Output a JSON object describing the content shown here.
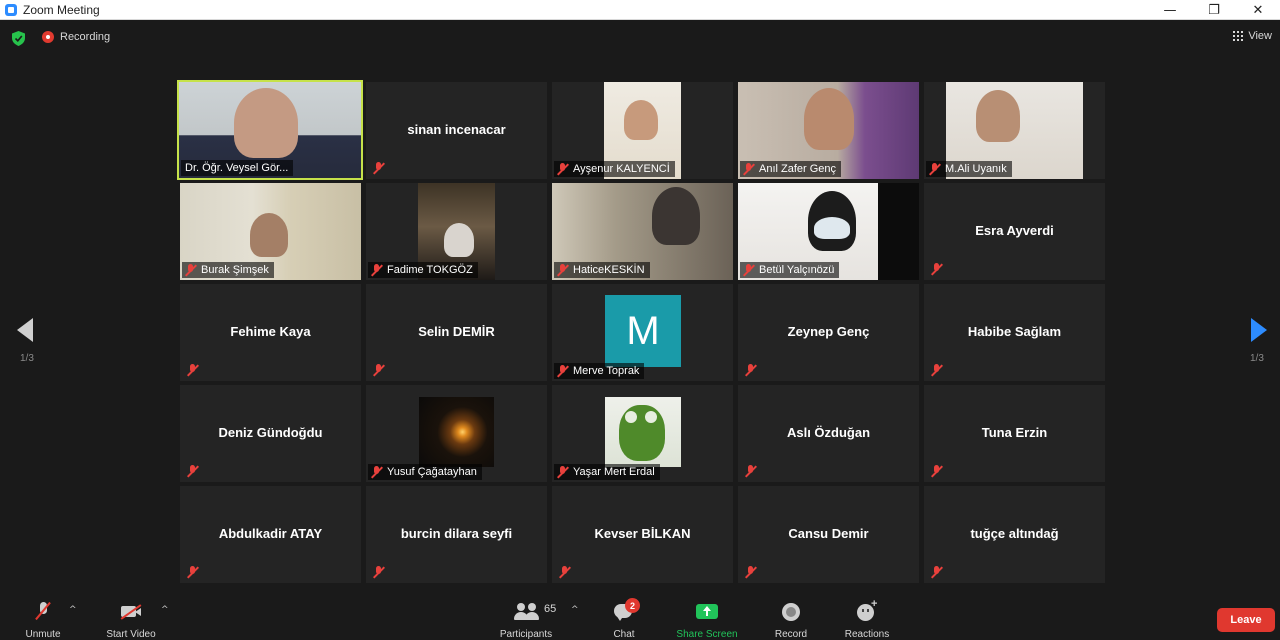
{
  "window": {
    "title": "Zoom Meeting",
    "controls": [
      "—",
      "❐",
      "✕"
    ]
  },
  "topbar": {
    "recording_label": "Recording",
    "view_label": "View"
  },
  "pagination": {
    "left": "1/3",
    "right": "1/3"
  },
  "participants": [
    {
      "name": "Dr. Öğr. Veysel Gör...",
      "video": true
    },
    {
      "name": "sinan incenacar",
      "video": false
    },
    {
      "name": "Ayşenur KALYENCİ",
      "video": true
    },
    {
      "name": "Anıl Zafer Genç",
      "video": true
    },
    {
      "name": "M.Ali Uyanık",
      "video": true
    },
    {
      "name": "Burak Şimşek",
      "video": true
    },
    {
      "name": "Fadime TOKGÖZ",
      "video": true
    },
    {
      "name": "HaticeKESKİN",
      "video": true
    },
    {
      "name": "Betül Yalçınözü",
      "video": true
    },
    {
      "name": "Esra Ayverdi",
      "video": false
    },
    {
      "name": "Fehime Kaya",
      "video": false
    },
    {
      "name": "Selin DEMİR",
      "video": false
    },
    {
      "name": "Merve Toprak",
      "avatar_letter": "M"
    },
    {
      "name": "Zeynep Genç",
      "video": false
    },
    {
      "name": "Habibe Sağlam",
      "video": false
    },
    {
      "name": "Deniz Gündoğdu",
      "video": false
    },
    {
      "name": "Yusuf Çağatayhan",
      "video": true
    },
    {
      "name": "Yaşar Mert Erdal",
      "video": true
    },
    {
      "name": "Aslı Özduğan",
      "video": false
    },
    {
      "name": "Tuna Erzin",
      "video": false
    },
    {
      "name": "Abdulkadir ATAY",
      "video": false
    },
    {
      "name": "burcin dilara seyfi",
      "video": false
    },
    {
      "name": "Kevser BİLKAN",
      "video": false
    },
    {
      "name": "Cansu Demir",
      "video": false
    },
    {
      "name": "tuğçe altındağ",
      "video": false
    }
  ],
  "toolbar": {
    "unmute": "Unmute",
    "start_video": "Start Video",
    "participants": "Participants",
    "participant_count": "65",
    "chat": "Chat",
    "chat_badge": "2",
    "share_screen": "Share Screen",
    "record": "Record",
    "reactions": "Reactions",
    "leave": "Leave"
  },
  "colors": {
    "background": "#1a1a1a",
    "tile": "#242424",
    "active_speaker": "#c6e24a",
    "muted_icon": "#e8413c",
    "share_green": "#21c45a",
    "leave_red": "#e0382f",
    "nav_blue": "#2d8cff"
  }
}
